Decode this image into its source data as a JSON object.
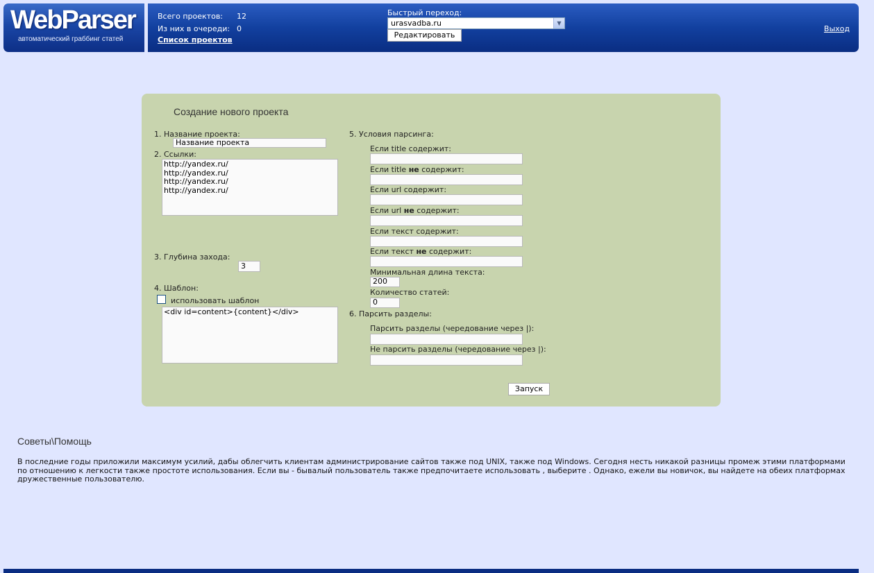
{
  "header": {
    "logo_title": "WebParser",
    "logo_subtitle": "автоматический граббинг статей",
    "total_projects_label": "Всего проектов:",
    "total_projects_value": "12",
    "queued_label": "Из них в очереди:",
    "queued_value": "0",
    "projects_list_link": "Список проектов",
    "quick_nav_label": "Быстрый переход:",
    "quick_nav_selected": "urasvadba.ru",
    "edit_button": "Редактировать",
    "logout_link": "Выход"
  },
  "form": {
    "title": "Создание нового проекта",
    "project_name_label": "1. Название проекта:",
    "project_name_value": "Название проекта",
    "links_label": "2. Ссылки:",
    "links_lines": [
      "http://yandex.ru/",
      "http://yandex.ru/",
      "http://yandex.ru/",
      "http://yandex.ru/"
    ],
    "depth_label": "3. Глубина захода:",
    "depth_value": "3",
    "template_label": "4. Шаблон:",
    "use_template_label": "использовать шаблон",
    "use_template_checked": false,
    "template_value": "<div id=content>{content}</div>",
    "conditions_label": "5. Условия парсинга:",
    "title_contains_label": "Если title содержит:",
    "title_not_contains": {
      "pre": "Если title ",
      "bold": "не",
      "post": " содержит:"
    },
    "url_contains_label": "Если url содержит:",
    "url_not_contains": {
      "pre": "Если url ",
      "bold": "не",
      "post": " содержит:"
    },
    "text_contains_label": "Если текст содержит:",
    "text_not_contains": {
      "pre": "Если текст ",
      "bold": "не",
      "post": " содержит:"
    },
    "min_length_label": "Минимальная длина текста:",
    "min_length_value": "200",
    "article_count_label": "Количество статей:",
    "article_count_value": "0",
    "sections_label": "6. Парсить разделы:",
    "parse_sections_label": "Парсить разделы (чередование через |):",
    "skip_sections_label": "Не парсить разделы (чередование через |):",
    "submit_button": "Запуск"
  },
  "help": {
    "title": "Советы\\Помощь",
    "text": "В последние годы приложили максимум усилий, дабы облегчить клиентам администрирование сайтов также под UNIX, также под Windows. Сегодня несть никакой разницы промеж этими платформами по отношению к легкости также простоте использования. Если вы - бывалый пользователь также предпочитаете использовать , выберите . Однако, ежели вы новичок, вы найдете на обеих платформах дружественные пользователю."
  },
  "colors": {
    "page_bg": "#e0e6ff",
    "header_blue": "#12409f",
    "panel_bg": "#c8d4ae"
  }
}
